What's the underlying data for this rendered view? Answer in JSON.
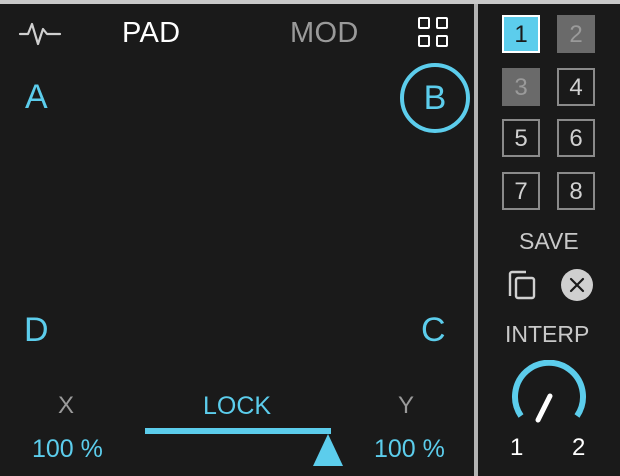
{
  "header": {
    "tabs": [
      {
        "label": "PAD",
        "active": true
      },
      {
        "label": "MOD",
        "active": false
      }
    ],
    "left_icon": "pulse-waveform-icon",
    "right_icon": "grid-four-squares-icon"
  },
  "pad": {
    "corners": {
      "a": "A",
      "b": "B",
      "c": "C",
      "d": "D"
    },
    "selected_corner": "B"
  },
  "controls": {
    "x_label": "X",
    "y_label": "Y",
    "lock_label": "LOCK",
    "x_value": "100 %",
    "y_value": "100 %",
    "lock_position": 0.9
  },
  "presets": {
    "slots": [
      "1",
      "2",
      "3",
      "4",
      "5",
      "6",
      "7",
      "8"
    ],
    "active": "1",
    "filled": [
      "2",
      "3"
    ],
    "save_label": "SAVE",
    "copy_icon": "copy-icon",
    "clear_icon": "close-circle-icon"
  },
  "interp": {
    "label": "INTERP",
    "min_label": "1",
    "max_label": "2",
    "value": 0.5
  },
  "colors": {
    "accent": "#5ccdec",
    "background": "#1a1a1a",
    "inactive_text": "#9a9a9a",
    "divider": "#b3b3b3"
  }
}
